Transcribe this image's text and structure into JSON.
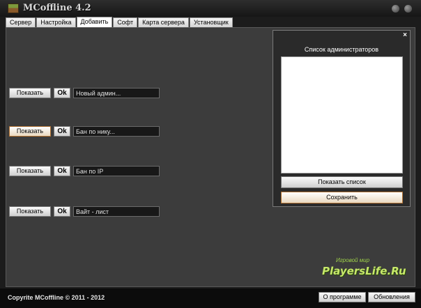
{
  "window": {
    "title": "MCoffline 4.2"
  },
  "tabs": [
    {
      "label": "Сервер"
    },
    {
      "label": "Настройка"
    },
    {
      "label": "Добавить"
    },
    {
      "label": "Софт"
    },
    {
      "label": "Карта сервера"
    },
    {
      "label": "Установщик"
    }
  ],
  "active_tab": "Добавить",
  "rows": [
    {
      "show_label": "Показать",
      "ok_label": "Ok",
      "value": "Новый админ..."
    },
    {
      "show_label": "Показать",
      "ok_label": "Ok",
      "value": "Бан по нику..."
    },
    {
      "show_label": "Показать",
      "ok_label": "Ok",
      "value": "Бан по IP"
    },
    {
      "show_label": "Показать",
      "ok_label": "Ok",
      "value": "Вайт - лист"
    }
  ],
  "admin_panel": {
    "close_glyph": "×",
    "title": "Список администраторов",
    "show_list_label": "Показать список",
    "save_label": "Сохранить"
  },
  "footer": {
    "copyright": "Copyrite MCoffline © 2011 - 2012",
    "about_label": "О программе",
    "updates_label": "Обновления"
  },
  "watermark": {
    "line1": "Игровой мир",
    "line2": "PlayersLife.Ru"
  },
  "colors": {
    "background": "#1c1c1c",
    "content": "#3c3c3c",
    "field": "#181818",
    "highlight_border": "#b07030",
    "watermark": "#c7e86a"
  }
}
